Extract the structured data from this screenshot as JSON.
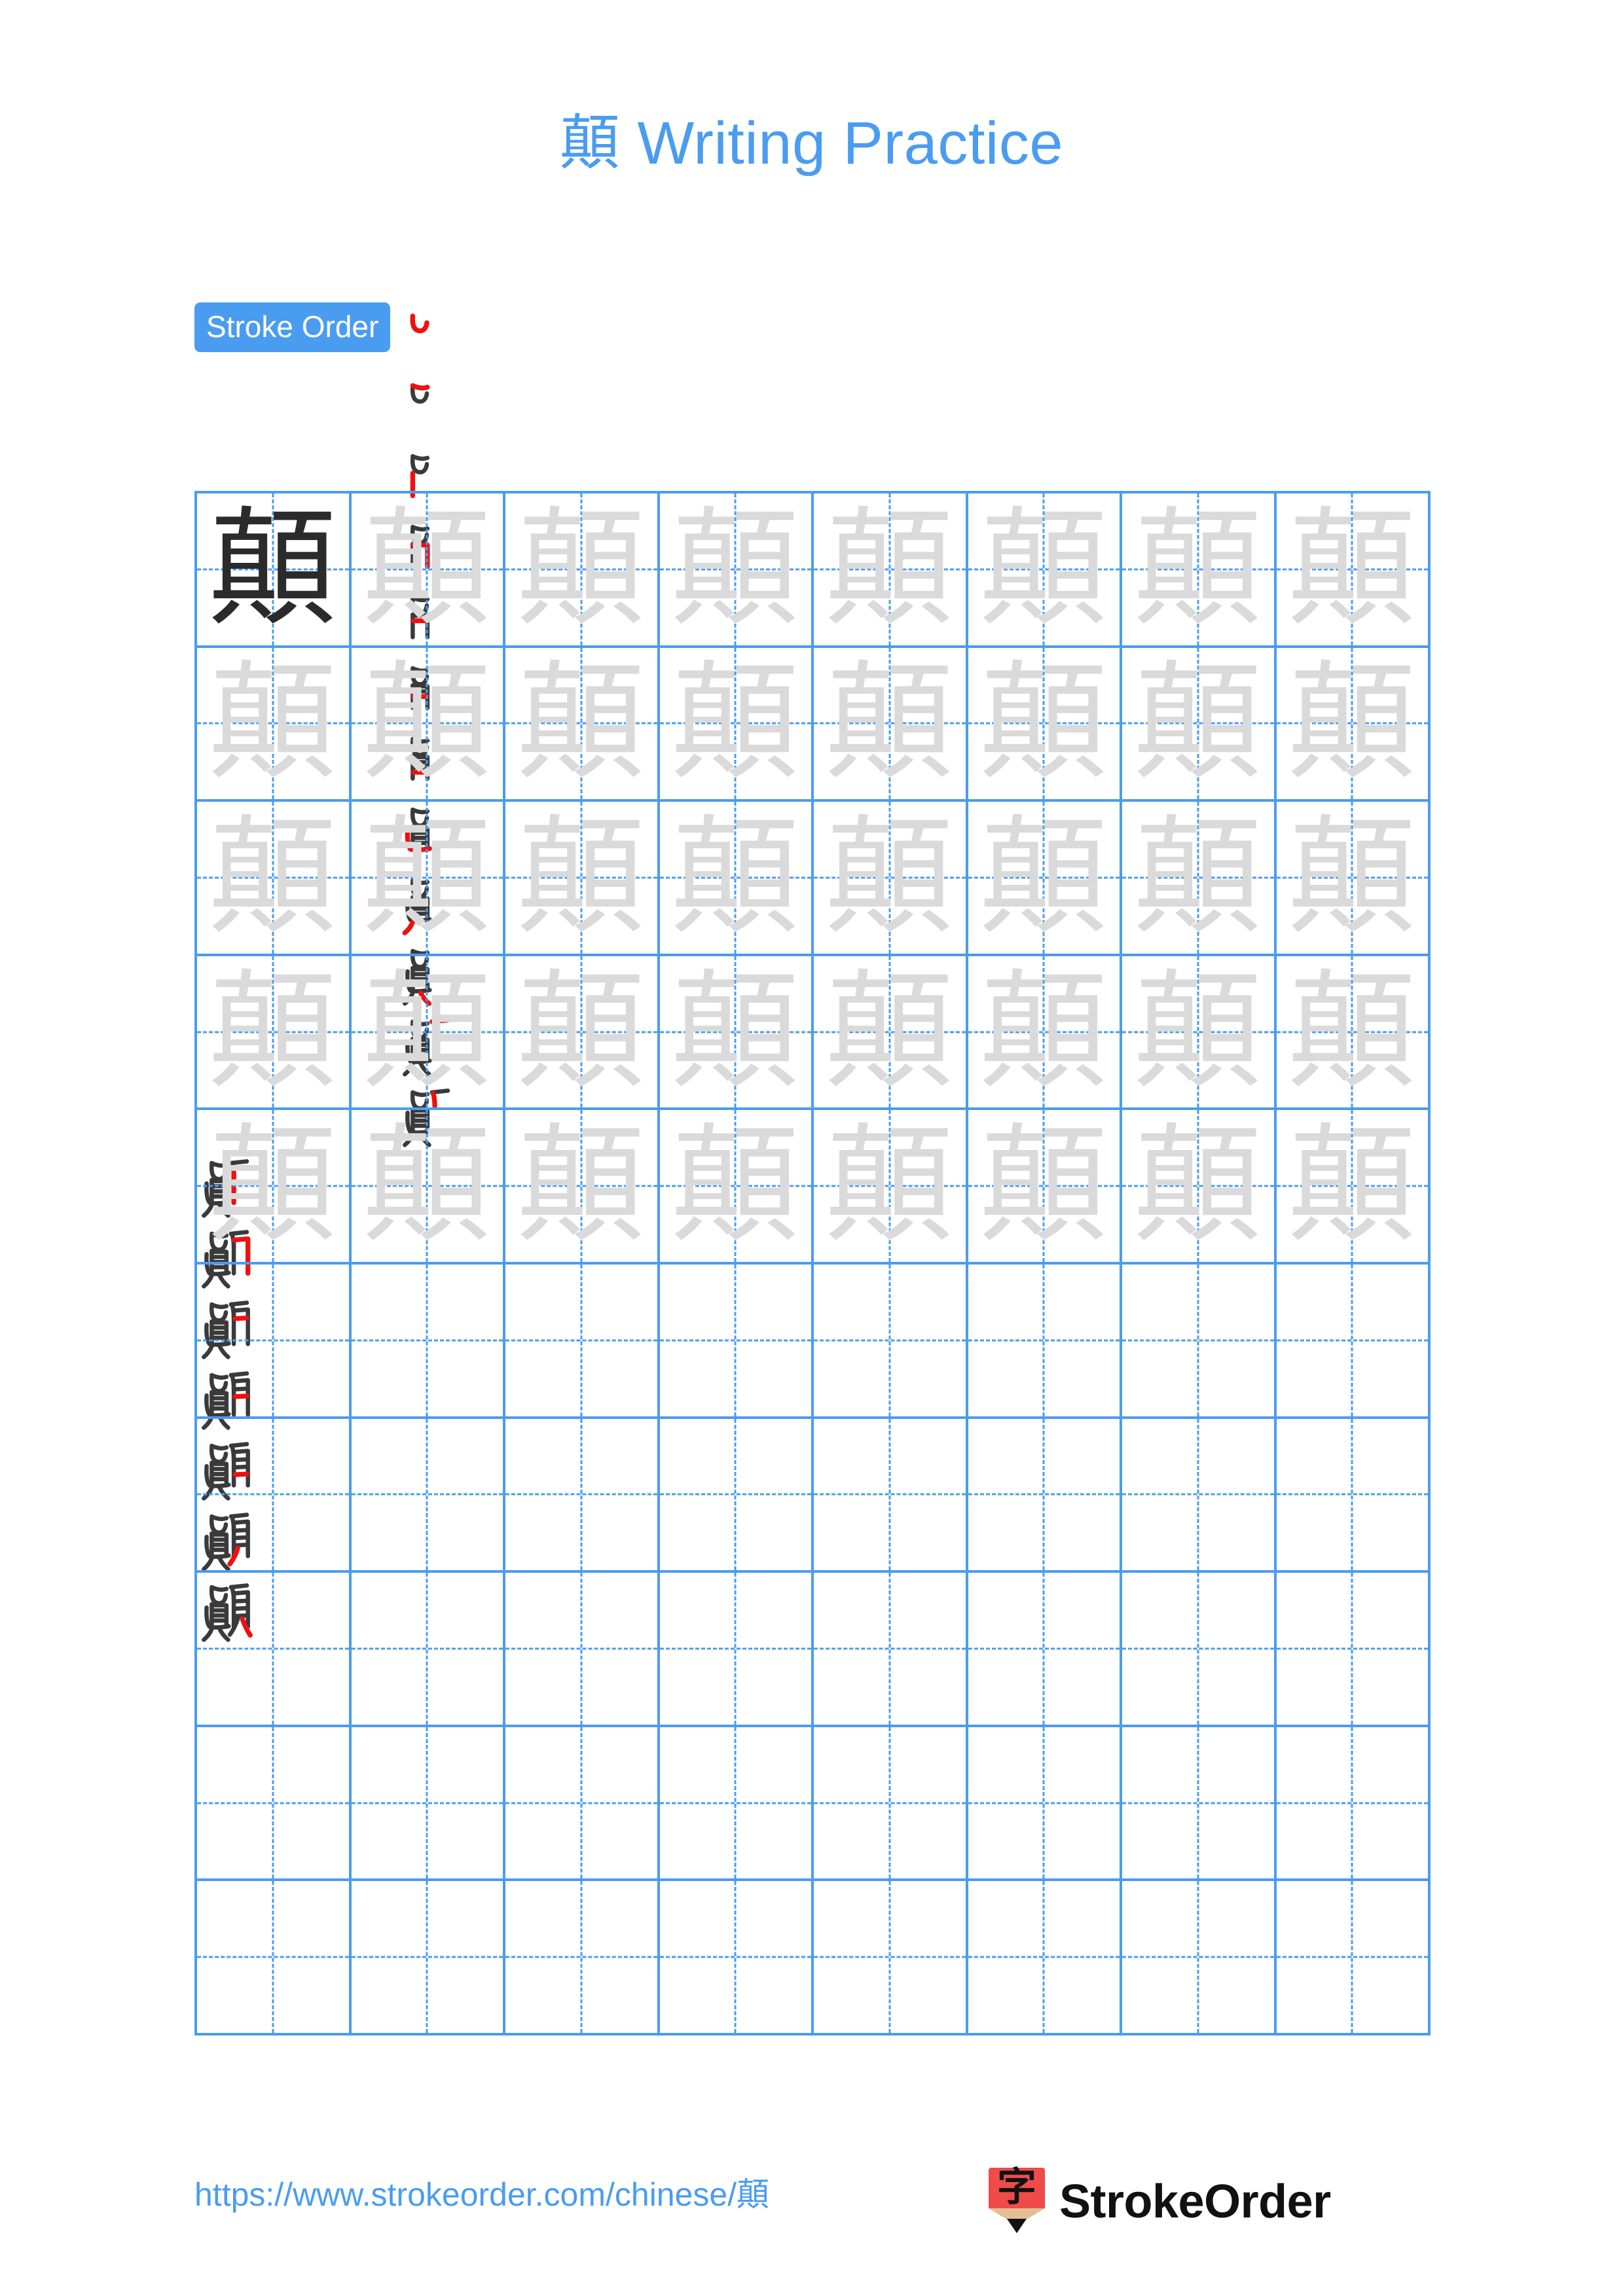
{
  "page": {
    "background_color": "#ffffff",
    "accent_color": "#4a9cf0",
    "character": "顛",
    "title": "顛 Writing Practice",
    "title_prefix": "顛",
    "title_suffix": " Writing Practice"
  },
  "stroke_order": {
    "badge_label": "Stroke Order",
    "badge_bg": "#4a9cf0",
    "badge_text_color": "#ffffff",
    "total_strokes": 19,
    "new_stroke_color": "#ee1111",
    "previous_stroke_color": "#3a3a3a",
    "rows": [
      {
        "count": 12,
        "indexes": [
          1,
          2,
          3,
          4,
          5,
          6,
          7,
          8,
          9,
          10,
          11,
          12
        ]
      },
      {
        "count": 7,
        "indexes": [
          13,
          14,
          15,
          16,
          17,
          18,
          19
        ]
      }
    ]
  },
  "practice_grid": {
    "columns": 8,
    "rows": 10,
    "total_cells": 80,
    "grid_line_color": "#4a9cf0",
    "guide_line_style": "dashed-cross",
    "model_char_color": "#2b2b2b",
    "trace_char_color": "#dadada",
    "model_cell_index": 0,
    "filled_cells": 40,
    "empty_cells": 40,
    "cells": [
      {
        "char": "顛",
        "style": "dark"
      },
      {
        "char": "顛",
        "style": "light"
      },
      {
        "char": "顛",
        "style": "light"
      },
      {
        "char": "顛",
        "style": "light"
      },
      {
        "char": "顛",
        "style": "light"
      },
      {
        "char": "顛",
        "style": "light"
      },
      {
        "char": "顛",
        "style": "light"
      },
      {
        "char": "顛",
        "style": "light"
      },
      {
        "char": "顛",
        "style": "light"
      },
      {
        "char": "顛",
        "style": "light"
      },
      {
        "char": "顛",
        "style": "light"
      },
      {
        "char": "顛",
        "style": "light"
      },
      {
        "char": "顛",
        "style": "light"
      },
      {
        "char": "顛",
        "style": "light"
      },
      {
        "char": "顛",
        "style": "light"
      },
      {
        "char": "顛",
        "style": "light"
      },
      {
        "char": "顛",
        "style": "light"
      },
      {
        "char": "顛",
        "style": "light"
      },
      {
        "char": "顛",
        "style": "light"
      },
      {
        "char": "顛",
        "style": "light"
      },
      {
        "char": "顛",
        "style": "light"
      },
      {
        "char": "顛",
        "style": "light"
      },
      {
        "char": "顛",
        "style": "light"
      },
      {
        "char": "顛",
        "style": "light"
      },
      {
        "char": "顛",
        "style": "light"
      },
      {
        "char": "顛",
        "style": "light"
      },
      {
        "char": "顛",
        "style": "light"
      },
      {
        "char": "顛",
        "style": "light"
      },
      {
        "char": "顛",
        "style": "light"
      },
      {
        "char": "顛",
        "style": "light"
      },
      {
        "char": "顛",
        "style": "light"
      },
      {
        "char": "顛",
        "style": "light"
      },
      {
        "char": "顛",
        "style": "light"
      },
      {
        "char": "顛",
        "style": "light"
      },
      {
        "char": "顛",
        "style": "light"
      },
      {
        "char": "顛",
        "style": "light"
      },
      {
        "char": "顛",
        "style": "light"
      },
      {
        "char": "顛",
        "style": "light"
      },
      {
        "char": "顛",
        "style": "light"
      },
      {
        "char": "顛",
        "style": "light"
      },
      {
        "char": "",
        "style": "empty"
      },
      {
        "char": "",
        "style": "empty"
      },
      {
        "char": "",
        "style": "empty"
      },
      {
        "char": "",
        "style": "empty"
      },
      {
        "char": "",
        "style": "empty"
      },
      {
        "char": "",
        "style": "empty"
      },
      {
        "char": "",
        "style": "empty"
      },
      {
        "char": "",
        "style": "empty"
      },
      {
        "char": "",
        "style": "empty"
      },
      {
        "char": "",
        "style": "empty"
      },
      {
        "char": "",
        "style": "empty"
      },
      {
        "char": "",
        "style": "empty"
      },
      {
        "char": "",
        "style": "empty"
      },
      {
        "char": "",
        "style": "empty"
      },
      {
        "char": "",
        "style": "empty"
      },
      {
        "char": "",
        "style": "empty"
      },
      {
        "char": "",
        "style": "empty"
      },
      {
        "char": "",
        "style": "empty"
      },
      {
        "char": "",
        "style": "empty"
      },
      {
        "char": "",
        "style": "empty"
      },
      {
        "char": "",
        "style": "empty"
      },
      {
        "char": "",
        "style": "empty"
      },
      {
        "char": "",
        "style": "empty"
      },
      {
        "char": "",
        "style": "empty"
      },
      {
        "char": "",
        "style": "empty"
      },
      {
        "char": "",
        "style": "empty"
      },
      {
        "char": "",
        "style": "empty"
      },
      {
        "char": "",
        "style": "empty"
      },
      {
        "char": "",
        "style": "empty"
      },
      {
        "char": "",
        "style": "empty"
      },
      {
        "char": "",
        "style": "empty"
      },
      {
        "char": "",
        "style": "empty"
      },
      {
        "char": "",
        "style": "empty"
      },
      {
        "char": "",
        "style": "empty"
      },
      {
        "char": "",
        "style": "empty"
      },
      {
        "char": "",
        "style": "empty"
      },
      {
        "char": "",
        "style": "empty"
      },
      {
        "char": "",
        "style": "empty"
      },
      {
        "char": "",
        "style": "empty"
      },
      {
        "char": "",
        "style": "empty"
      }
    ]
  },
  "footer": {
    "url": "https://www.strokeorder.com/chinese/顛",
    "url_color": "#4a9cf0",
    "brand_name": "StrokeOrder",
    "brand_logo_char": "字",
    "brand_logo_color": "#ef4b4b"
  }
}
